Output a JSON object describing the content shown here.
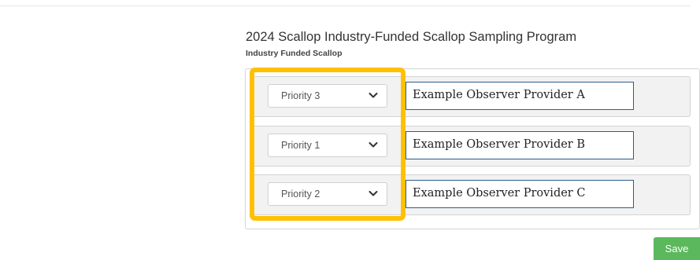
{
  "program": {
    "title": "2024 Scallop Industry-Funded Scallop Sampling Program",
    "subtitle": "Industry Funded Scallop"
  },
  "rows": [
    {
      "priority": "Priority 3",
      "provider": "Example Observer Provider A"
    },
    {
      "priority": "Priority 1",
      "provider": "Example Observer Provider B"
    },
    {
      "priority": "Priority 2",
      "provider": "Example Observer Provider C"
    }
  ],
  "icons": {
    "dropdown": "chevron-down-icon"
  },
  "colors": {
    "highlight": "#ffc000",
    "save_button": "#5cb85c",
    "provider_border": "#2c5d8a"
  },
  "actions": {
    "save_label": "Save"
  }
}
